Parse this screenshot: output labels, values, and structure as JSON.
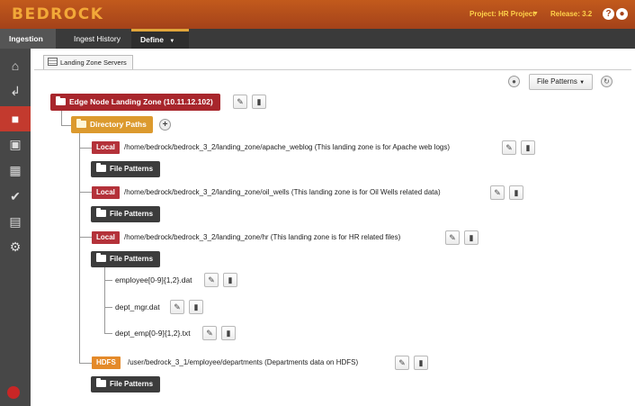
{
  "header": {
    "logo": "BEDROCK",
    "project": "Project: HR Project",
    "release": "Release: 3.2",
    "help_icon": "question-icon",
    "user_icon": "user-icon",
    "brand_color": "#b04a1b",
    "accent_color": "#ffd24a"
  },
  "tabs": {
    "ingestion": "Ingestion",
    "ingest_history": "Ingest History",
    "define": "Define"
  },
  "sidebar": {
    "icons": [
      "home-icon",
      "workflow-icon",
      "landing-zone-icon",
      "briefcase-icon",
      "grid-icon",
      "check-icon",
      "clipboard-icon",
      "gear-icon"
    ],
    "active": "landing-zone-icon"
  },
  "subtab": {
    "label": "Landing Zone Servers"
  },
  "toolbar": {
    "file_patterns_label": "File Patterns"
  },
  "tree": {
    "root_label": "Edge Node Landing Zone (10.11.12.102)",
    "directory_paths_label": "Directory Paths",
    "file_patterns_label": "File Patterns",
    "entries": [
      {
        "type": "Local",
        "path": "/home/bedrock/bedrock_3_2/landing_zone/apache_weblog (This landing zone is for Apache web logs)"
      },
      {
        "type": "Local",
        "path": "/home/bedrock/bedrock_3_2/landing_zone/oil_wells (This landing zone is for Oil Wells related data)"
      },
      {
        "type": "Local",
        "path": "/home/bedrock/bedrock_3_2/landing_zone/hr (This landing zone is for HR related files)"
      },
      {
        "type": "HDFS",
        "path": "/user/bedrock_3_1/employee/departments (Departments data on HDFS)"
      }
    ],
    "hr_files": [
      "employee[0-9]{1,2}.dat",
      "dept_mgr.dat",
      "dept_emp[0-9]{1,2}.txt"
    ]
  }
}
